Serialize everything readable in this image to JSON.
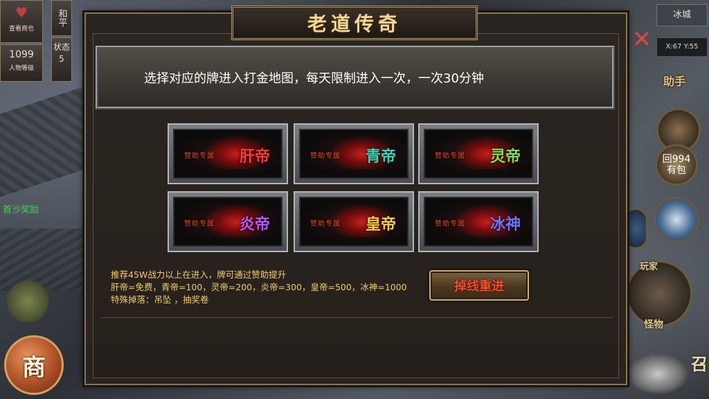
{
  "hud_left": {
    "avatar_label": "查看商也",
    "peace_label": "和平",
    "state_label": "状态",
    "state_value": "5",
    "power_value": "1099",
    "power_label": "人物等级",
    "sand_reward": "首沙奖励",
    "shop_label": "商"
  },
  "hud_right": {
    "map_name": "冰城",
    "coords": "X:67 Y:55",
    "helper_label": "助手",
    "gift_line1": "回994",
    "gift_line2": "有包",
    "player_label": "玩家",
    "monster_label": "怪物",
    "summon_label": "召"
  },
  "dialog": {
    "title": "老道传奇",
    "notice": "选择对应的牌进入打金地图，每天限制进入一次，一次30分钟",
    "plaques": [
      {
        "sponsor": "赞助专属",
        "name": "肝帝",
        "color": "#ff3a3a"
      },
      {
        "sponsor": "赞助专属",
        "name": "青帝",
        "color": "#39d4b8"
      },
      {
        "sponsor": "赞助专属",
        "name": "灵帝",
        "color": "#7ee05a"
      },
      {
        "sponsor": "赞助专属",
        "name": "炎帝",
        "color": "#b05aff"
      },
      {
        "sponsor": "赞助专属",
        "name": "皇帝",
        "color": "#f2cf4a"
      },
      {
        "sponsor": "赞助专属",
        "name": "冰神",
        "color": "#6a74ff"
      }
    ],
    "info_line1": "推荐45W战力以上在进入，牌可通过赞助提升",
    "info_line2": "肝帝=免费，青帝=100，灵帝=200，炎帝=300，皇帝=500，冰神=1000",
    "info_line3": "特殊掉落：吊坠 ，抽奖卷",
    "reconnect_button": "掉线重进"
  },
  "colors": {
    "info_text": "#f2cc6a",
    "button_text": "#ff4a2a",
    "title_text": "#f0d79a",
    "close": "#e0463c"
  }
}
